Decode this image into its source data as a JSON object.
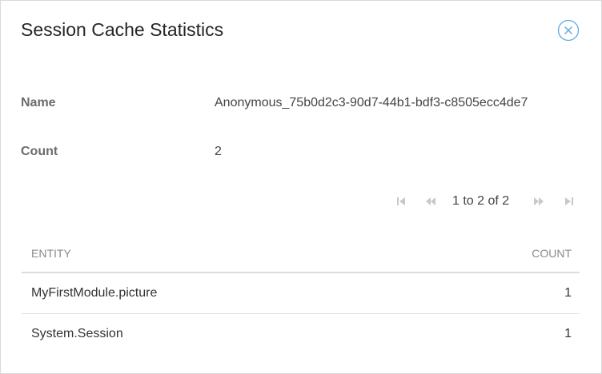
{
  "dialog": {
    "title": "Session Cache Statistics",
    "close_icon": "close-circle-icon"
  },
  "fields": [
    {
      "label": "Name",
      "value": "Anonymous_75b0d2c3-90d7-44b1-bdf3-c8505ecc4de7"
    },
    {
      "label": "Count",
      "value": "2"
    }
  ],
  "pager": {
    "status": "1 to 2 of 2",
    "icons": [
      "first-page-icon",
      "previous-page-icon",
      "next-page-icon",
      "last-page-icon"
    ]
  },
  "table": {
    "columns": [
      "ENTITY",
      "COUNT"
    ],
    "rows": [
      {
        "entity": "MyFirstModule.picture",
        "count": "1"
      },
      {
        "entity": "System.Session",
        "count": "1"
      }
    ]
  },
  "colors": {
    "accent": "#5aa9e6",
    "pager_icon": "#c8c8c8",
    "text": "#262626",
    "label": "#6b6b6b"
  }
}
